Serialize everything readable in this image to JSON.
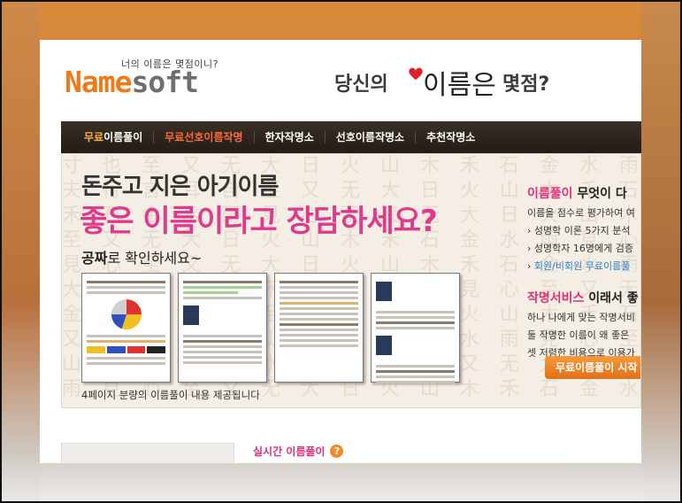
{
  "header": {
    "tagline": "너의 이름은 몇점이니?",
    "logo_name": "Name",
    "logo_soft": "soft",
    "slogan_left": "당신의",
    "slogan_big": "이름은",
    "slogan_right": "몇점?"
  },
  "nav": {
    "items": [
      {
        "accent": "무료",
        "label": "이름풀이"
      },
      {
        "accent": "",
        "label": "무료선호이름작명"
      },
      {
        "accent": "",
        "label": "한자작명소"
      },
      {
        "accent": "",
        "label": "선호이름작명소"
      },
      {
        "accent": "",
        "label": "추천작명소"
      }
    ]
  },
  "banner": {
    "headline1": "돈주고 지은 아기이름",
    "headline2": "좋은 이름이라고 장담하세요?",
    "check_bold": "공짜",
    "check_rest": "로 확인하세요~",
    "caption": "4페이지 분량의 이름풀이 내용 제공됩니다",
    "side": {
      "title1_hl": "이름풀이",
      "title1_rest": " 무엇이 다",
      "line1": "이름을 점수로 평가하여 여",
      "line2": "› 성명학 이론 5가지 분석",
      "line3": "› 성명학자 16명에게 검증",
      "line4_prefix": "› ",
      "line4_link": "회원/비회원 무료이름풀",
      "title2_hl": "작명서비스",
      "title2_rest": " 이래서 좋",
      "line5": "하나 나에게 맞는 작명서비",
      "line6": "둘 작명한 이름이 왜 좋은",
      "line7": "셋 저렴한 비용으로 이용가"
    },
    "start_button": "무료이름풀이 시작"
  },
  "bottom": {
    "live_title": "실시간 이름풀이",
    "help_glyph": "?"
  },
  "colors": {
    "brand_orange": "#f07a1a",
    "accent_pink": "#e03a8c",
    "nav_dark": "#2a2219"
  }
}
